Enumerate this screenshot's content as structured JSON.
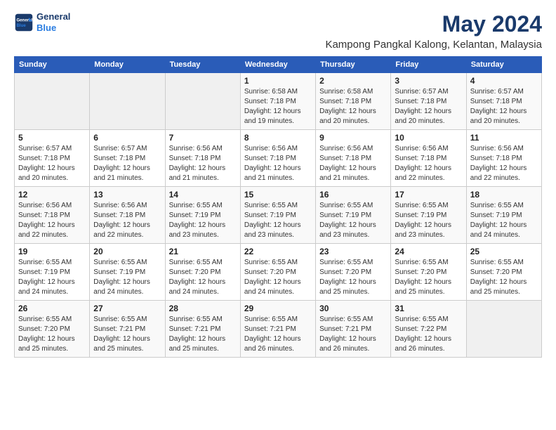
{
  "header": {
    "logo_line1": "General",
    "logo_line2": "Blue",
    "title": "May 2024",
    "subtitle": "Kampong Pangkal Kalong, Kelantan, Malaysia"
  },
  "weekdays": [
    "Sunday",
    "Monday",
    "Tuesday",
    "Wednesday",
    "Thursday",
    "Friday",
    "Saturday"
  ],
  "weeks": [
    [
      {
        "day": "",
        "sunrise": "",
        "sunset": "",
        "daylight": ""
      },
      {
        "day": "",
        "sunrise": "",
        "sunset": "",
        "daylight": ""
      },
      {
        "day": "",
        "sunrise": "",
        "sunset": "",
        "daylight": ""
      },
      {
        "day": "1",
        "sunrise": "Sunrise: 6:58 AM",
        "sunset": "Sunset: 7:18 PM",
        "daylight": "Daylight: 12 hours and 19 minutes."
      },
      {
        "day": "2",
        "sunrise": "Sunrise: 6:58 AM",
        "sunset": "Sunset: 7:18 PM",
        "daylight": "Daylight: 12 hours and 20 minutes."
      },
      {
        "day": "3",
        "sunrise": "Sunrise: 6:57 AM",
        "sunset": "Sunset: 7:18 PM",
        "daylight": "Daylight: 12 hours and 20 minutes."
      },
      {
        "day": "4",
        "sunrise": "Sunrise: 6:57 AM",
        "sunset": "Sunset: 7:18 PM",
        "daylight": "Daylight: 12 hours and 20 minutes."
      }
    ],
    [
      {
        "day": "5",
        "sunrise": "Sunrise: 6:57 AM",
        "sunset": "Sunset: 7:18 PM",
        "daylight": "Daylight: 12 hours and 20 minutes."
      },
      {
        "day": "6",
        "sunrise": "Sunrise: 6:57 AM",
        "sunset": "Sunset: 7:18 PM",
        "daylight": "Daylight: 12 hours and 21 minutes."
      },
      {
        "day": "7",
        "sunrise": "Sunrise: 6:56 AM",
        "sunset": "Sunset: 7:18 PM",
        "daylight": "Daylight: 12 hours and 21 minutes."
      },
      {
        "day": "8",
        "sunrise": "Sunrise: 6:56 AM",
        "sunset": "Sunset: 7:18 PM",
        "daylight": "Daylight: 12 hours and 21 minutes."
      },
      {
        "day": "9",
        "sunrise": "Sunrise: 6:56 AM",
        "sunset": "Sunset: 7:18 PM",
        "daylight": "Daylight: 12 hours and 21 minutes."
      },
      {
        "day": "10",
        "sunrise": "Sunrise: 6:56 AM",
        "sunset": "Sunset: 7:18 PM",
        "daylight": "Daylight: 12 hours and 22 minutes."
      },
      {
        "day": "11",
        "sunrise": "Sunrise: 6:56 AM",
        "sunset": "Sunset: 7:18 PM",
        "daylight": "Daylight: 12 hours and 22 minutes."
      }
    ],
    [
      {
        "day": "12",
        "sunrise": "Sunrise: 6:56 AM",
        "sunset": "Sunset: 7:18 PM",
        "daylight": "Daylight: 12 hours and 22 minutes."
      },
      {
        "day": "13",
        "sunrise": "Sunrise: 6:56 AM",
        "sunset": "Sunset: 7:18 PM",
        "daylight": "Daylight: 12 hours and 22 minutes."
      },
      {
        "day": "14",
        "sunrise": "Sunrise: 6:55 AM",
        "sunset": "Sunset: 7:19 PM",
        "daylight": "Daylight: 12 hours and 23 minutes."
      },
      {
        "day": "15",
        "sunrise": "Sunrise: 6:55 AM",
        "sunset": "Sunset: 7:19 PM",
        "daylight": "Daylight: 12 hours and 23 minutes."
      },
      {
        "day": "16",
        "sunrise": "Sunrise: 6:55 AM",
        "sunset": "Sunset: 7:19 PM",
        "daylight": "Daylight: 12 hours and 23 minutes."
      },
      {
        "day": "17",
        "sunrise": "Sunrise: 6:55 AM",
        "sunset": "Sunset: 7:19 PM",
        "daylight": "Daylight: 12 hours and 23 minutes."
      },
      {
        "day": "18",
        "sunrise": "Sunrise: 6:55 AM",
        "sunset": "Sunset: 7:19 PM",
        "daylight": "Daylight: 12 hours and 24 minutes."
      }
    ],
    [
      {
        "day": "19",
        "sunrise": "Sunrise: 6:55 AM",
        "sunset": "Sunset: 7:19 PM",
        "daylight": "Daylight: 12 hours and 24 minutes."
      },
      {
        "day": "20",
        "sunrise": "Sunrise: 6:55 AM",
        "sunset": "Sunset: 7:19 PM",
        "daylight": "Daylight: 12 hours and 24 minutes."
      },
      {
        "day": "21",
        "sunrise": "Sunrise: 6:55 AM",
        "sunset": "Sunset: 7:20 PM",
        "daylight": "Daylight: 12 hours and 24 minutes."
      },
      {
        "day": "22",
        "sunrise": "Sunrise: 6:55 AM",
        "sunset": "Sunset: 7:20 PM",
        "daylight": "Daylight: 12 hours and 24 minutes."
      },
      {
        "day": "23",
        "sunrise": "Sunrise: 6:55 AM",
        "sunset": "Sunset: 7:20 PM",
        "daylight": "Daylight: 12 hours and 25 minutes."
      },
      {
        "day": "24",
        "sunrise": "Sunrise: 6:55 AM",
        "sunset": "Sunset: 7:20 PM",
        "daylight": "Daylight: 12 hours and 25 minutes."
      },
      {
        "day": "25",
        "sunrise": "Sunrise: 6:55 AM",
        "sunset": "Sunset: 7:20 PM",
        "daylight": "Daylight: 12 hours and 25 minutes."
      }
    ],
    [
      {
        "day": "26",
        "sunrise": "Sunrise: 6:55 AM",
        "sunset": "Sunset: 7:20 PM",
        "daylight": "Daylight: 12 hours and 25 minutes."
      },
      {
        "day": "27",
        "sunrise": "Sunrise: 6:55 AM",
        "sunset": "Sunset: 7:21 PM",
        "daylight": "Daylight: 12 hours and 25 minutes."
      },
      {
        "day": "28",
        "sunrise": "Sunrise: 6:55 AM",
        "sunset": "Sunset: 7:21 PM",
        "daylight": "Daylight: 12 hours and 25 minutes."
      },
      {
        "day": "29",
        "sunrise": "Sunrise: 6:55 AM",
        "sunset": "Sunset: 7:21 PM",
        "daylight": "Daylight: 12 hours and 26 minutes."
      },
      {
        "day": "30",
        "sunrise": "Sunrise: 6:55 AM",
        "sunset": "Sunset: 7:21 PM",
        "daylight": "Daylight: 12 hours and 26 minutes."
      },
      {
        "day": "31",
        "sunrise": "Sunrise: 6:55 AM",
        "sunset": "Sunset: 7:22 PM",
        "daylight": "Daylight: 12 hours and 26 minutes."
      },
      {
        "day": "",
        "sunrise": "",
        "sunset": "",
        "daylight": ""
      }
    ]
  ]
}
